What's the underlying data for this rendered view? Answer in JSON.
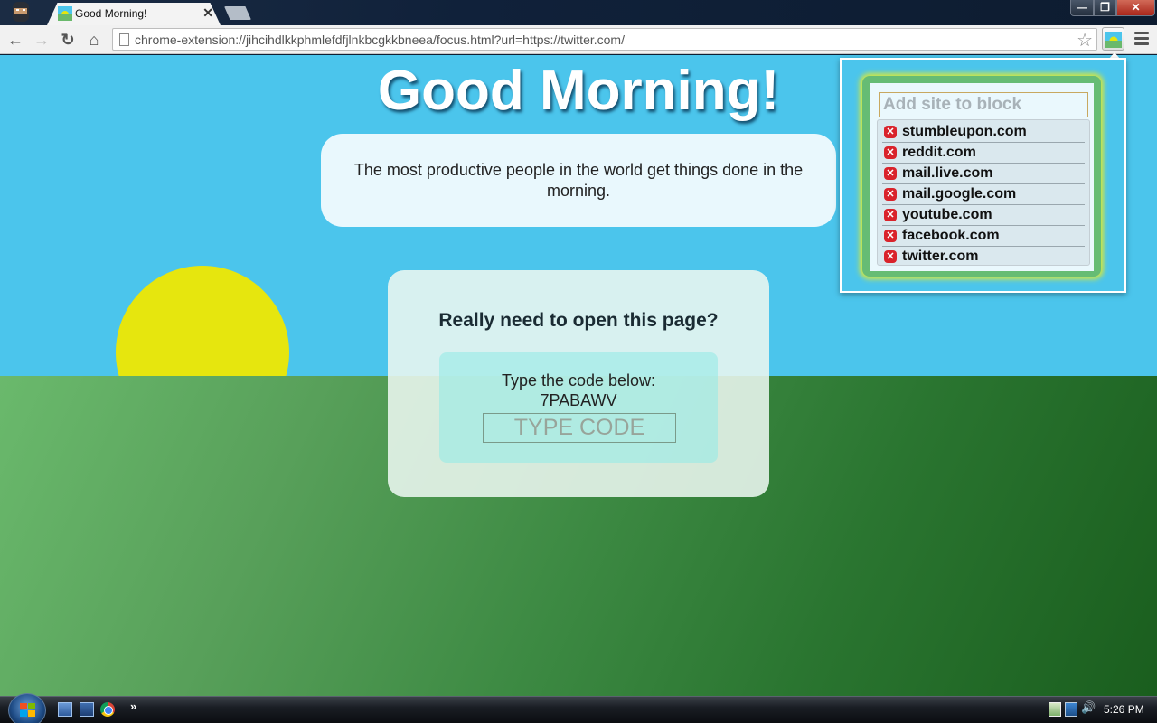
{
  "browser": {
    "tab": {
      "title": "Good Morning!",
      "favicon": "sunrise-icon",
      "close_glyph": "✕"
    },
    "window_controls": {
      "minimize_glyph": "—",
      "maximize_glyph": "❐",
      "close_glyph": "✕"
    },
    "toolbar": {
      "back_glyph": "←",
      "forward_glyph": "→",
      "reload_glyph": "↻",
      "home_glyph": "⌂",
      "url": "chrome-extension://jihcihdlkkphmlefdfjlnkbcgkkbneea/focus.html?url=https://twitter.com/",
      "star_glyph": "☆",
      "extension_icon": "sunrise-icon",
      "menu_icon": "hamburger-icon"
    }
  },
  "page": {
    "headline": "Good Morning!",
    "quote": "The most productive people in the world get things done in the morning.",
    "confirm": {
      "title": "Really need to open this page?",
      "code_label": "Type the code below:",
      "code": "7PABAWV",
      "input_placeholder": "TYPE CODE",
      "input_value": ""
    },
    "colors": {
      "sky": "#4bc5ec",
      "sun": "#e6e60e",
      "grass_light": "#6ab96c",
      "grass_dark": "#1a5e1e"
    }
  },
  "popup": {
    "input_placeholder": "Add site to block",
    "input_value": "",
    "remove_glyph": "✕",
    "blocked_sites": [
      "stumbleupon.com",
      "reddit.com",
      "mail.live.com",
      "mail.google.com",
      "youtube.com",
      "facebook.com",
      "twitter.com"
    ]
  },
  "taskbar": {
    "more_glyph": "»",
    "volume_glyph": "🔊",
    "clock": "5:26 PM"
  }
}
